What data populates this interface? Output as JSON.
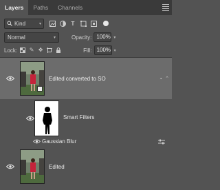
{
  "tabs": [
    {
      "label": "Layers",
      "active": true
    },
    {
      "label": "Paths",
      "active": false
    },
    {
      "label": "Channels",
      "active": false
    }
  ],
  "filter": {
    "kind_label": "Kind",
    "icons": [
      "image-icon",
      "adjustment-icon",
      "type-icon",
      "shape-icon",
      "smart-object-icon"
    ]
  },
  "blend": {
    "mode": "Normal",
    "opacity_label": "Opacity:",
    "opacity_value": "100%"
  },
  "lock": {
    "label": "Lock:",
    "fill_label": "Fill:",
    "fill_value": "100%"
  },
  "layers": [
    {
      "name": "Edited converted to SO",
      "selected": true,
      "smart_object": true
    },
    {
      "name": "Edited",
      "selected": false
    }
  ],
  "smart_filters": {
    "label": "Smart Filters",
    "filters": [
      "Gaussian Blur"
    ]
  },
  "colors": {
    "panel": "#535353",
    "selected_row": "#6c6c6c",
    "tabbar": "#3a3a3a"
  }
}
